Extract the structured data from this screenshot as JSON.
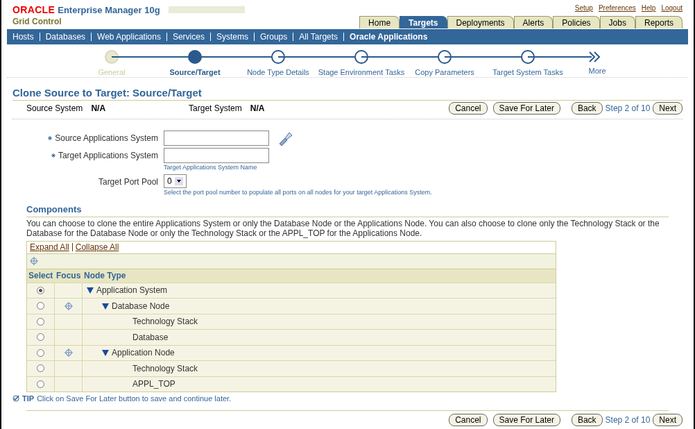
{
  "header": {
    "logo": "ORACLE",
    "product": "Enterprise Manager 10g",
    "subtitle": "Grid Control",
    "global_links": [
      "Setup",
      "Preferences",
      "Help",
      "Logout"
    ],
    "tabs": [
      {
        "label": "Home",
        "selected": false
      },
      {
        "label": "Targets",
        "selected": true
      },
      {
        "label": "Deployments",
        "selected": false
      },
      {
        "label": "Alerts",
        "selected": false
      },
      {
        "label": "Policies",
        "selected": false
      },
      {
        "label": "Jobs",
        "selected": false
      },
      {
        "label": "Reports",
        "selected": false
      }
    ]
  },
  "subnav": [
    {
      "label": "Hosts",
      "selected": false
    },
    {
      "label": "Databases",
      "selected": false
    },
    {
      "label": "Web Applications",
      "selected": false
    },
    {
      "label": "Services",
      "selected": false
    },
    {
      "label": "Systems",
      "selected": false
    },
    {
      "label": "Groups",
      "selected": false
    },
    {
      "label": "All Targets",
      "selected": false
    },
    {
      "label": "Oracle Applications",
      "selected": true
    }
  ],
  "train": {
    "steps": [
      {
        "label": "General",
        "visited": true,
        "selected": false
      },
      {
        "label": "Source/Target",
        "visited": false,
        "selected": true
      },
      {
        "label": "Node Type Details",
        "visited": false,
        "selected": false
      },
      {
        "label": "Stage Environment Tasks",
        "visited": false,
        "selected": false
      },
      {
        "label": "Copy Parameters",
        "visited": false,
        "selected": false
      },
      {
        "label": "Target System Tasks",
        "visited": false,
        "selected": false
      }
    ],
    "more": "More"
  },
  "title": "Clone Source to Target: Source/Target",
  "summary": [
    {
      "label": "Source System",
      "value": "N/A"
    },
    {
      "label": "Target System",
      "value": "N/A"
    }
  ],
  "top_buttons": {
    "cancel": "Cancel",
    "save": "Save For Later",
    "back": "Back",
    "step": "Step 2 of 10",
    "next": "Next"
  },
  "form": [
    {
      "kind": "text",
      "label": "Source Applications System",
      "required": true,
      "search": true
    },
    {
      "kind": "text",
      "label": "Target Applications System",
      "required": true,
      "search": false,
      "hint": "Target Applications System Name"
    },
    {
      "kind": "select",
      "label": "Target Port Pool",
      "required": false,
      "search": false,
      "value": "0",
      "hint": "Select the port pool number to populate all ports on all nodes for your target Applications System."
    }
  ],
  "components": {
    "heading": "Components",
    "description": "You can choose to clone the entire Applications System or only the Database Node or the Applications Node. You can also choose to clone only the Technology Stack or the Database for the Database Node or only the Technology Stack or the APPL_TOP for the Applications Node.",
    "expand_all": "Expand All",
    "collapse_all": "Collapse All",
    "columns": [
      "Select",
      "Focus",
      "Node Type"
    ],
    "rows": [
      {
        "label": "Application System",
        "selected": true,
        "focus": false,
        "expanded": true,
        "children": [
          {
            "label": "Database Node",
            "selected": false,
            "focus": true,
            "expanded": true,
            "children": [
              {
                "label": "Technology Stack",
                "selected": false,
                "focus": false
              },
              {
                "label": "Database",
                "selected": false,
                "focus": false
              }
            ]
          },
          {
            "label": "Application Node",
            "selected": false,
            "focus": true,
            "expanded": true,
            "children": [
              {
                "label": "Technology Stack",
                "selected": false,
                "focus": false
              },
              {
                "label": "APPL_TOP",
                "selected": false,
                "focus": false
              }
            ]
          }
        ]
      }
    ]
  },
  "tip": {
    "label": "TIP",
    "text": "Click on Save For Later button to save and continue later."
  },
  "bottom_buttons": {
    "cancel": "Cancel",
    "save": "Save For Later",
    "back": "Back",
    "step": "Step 2 of 10",
    "next": "Next"
  }
}
